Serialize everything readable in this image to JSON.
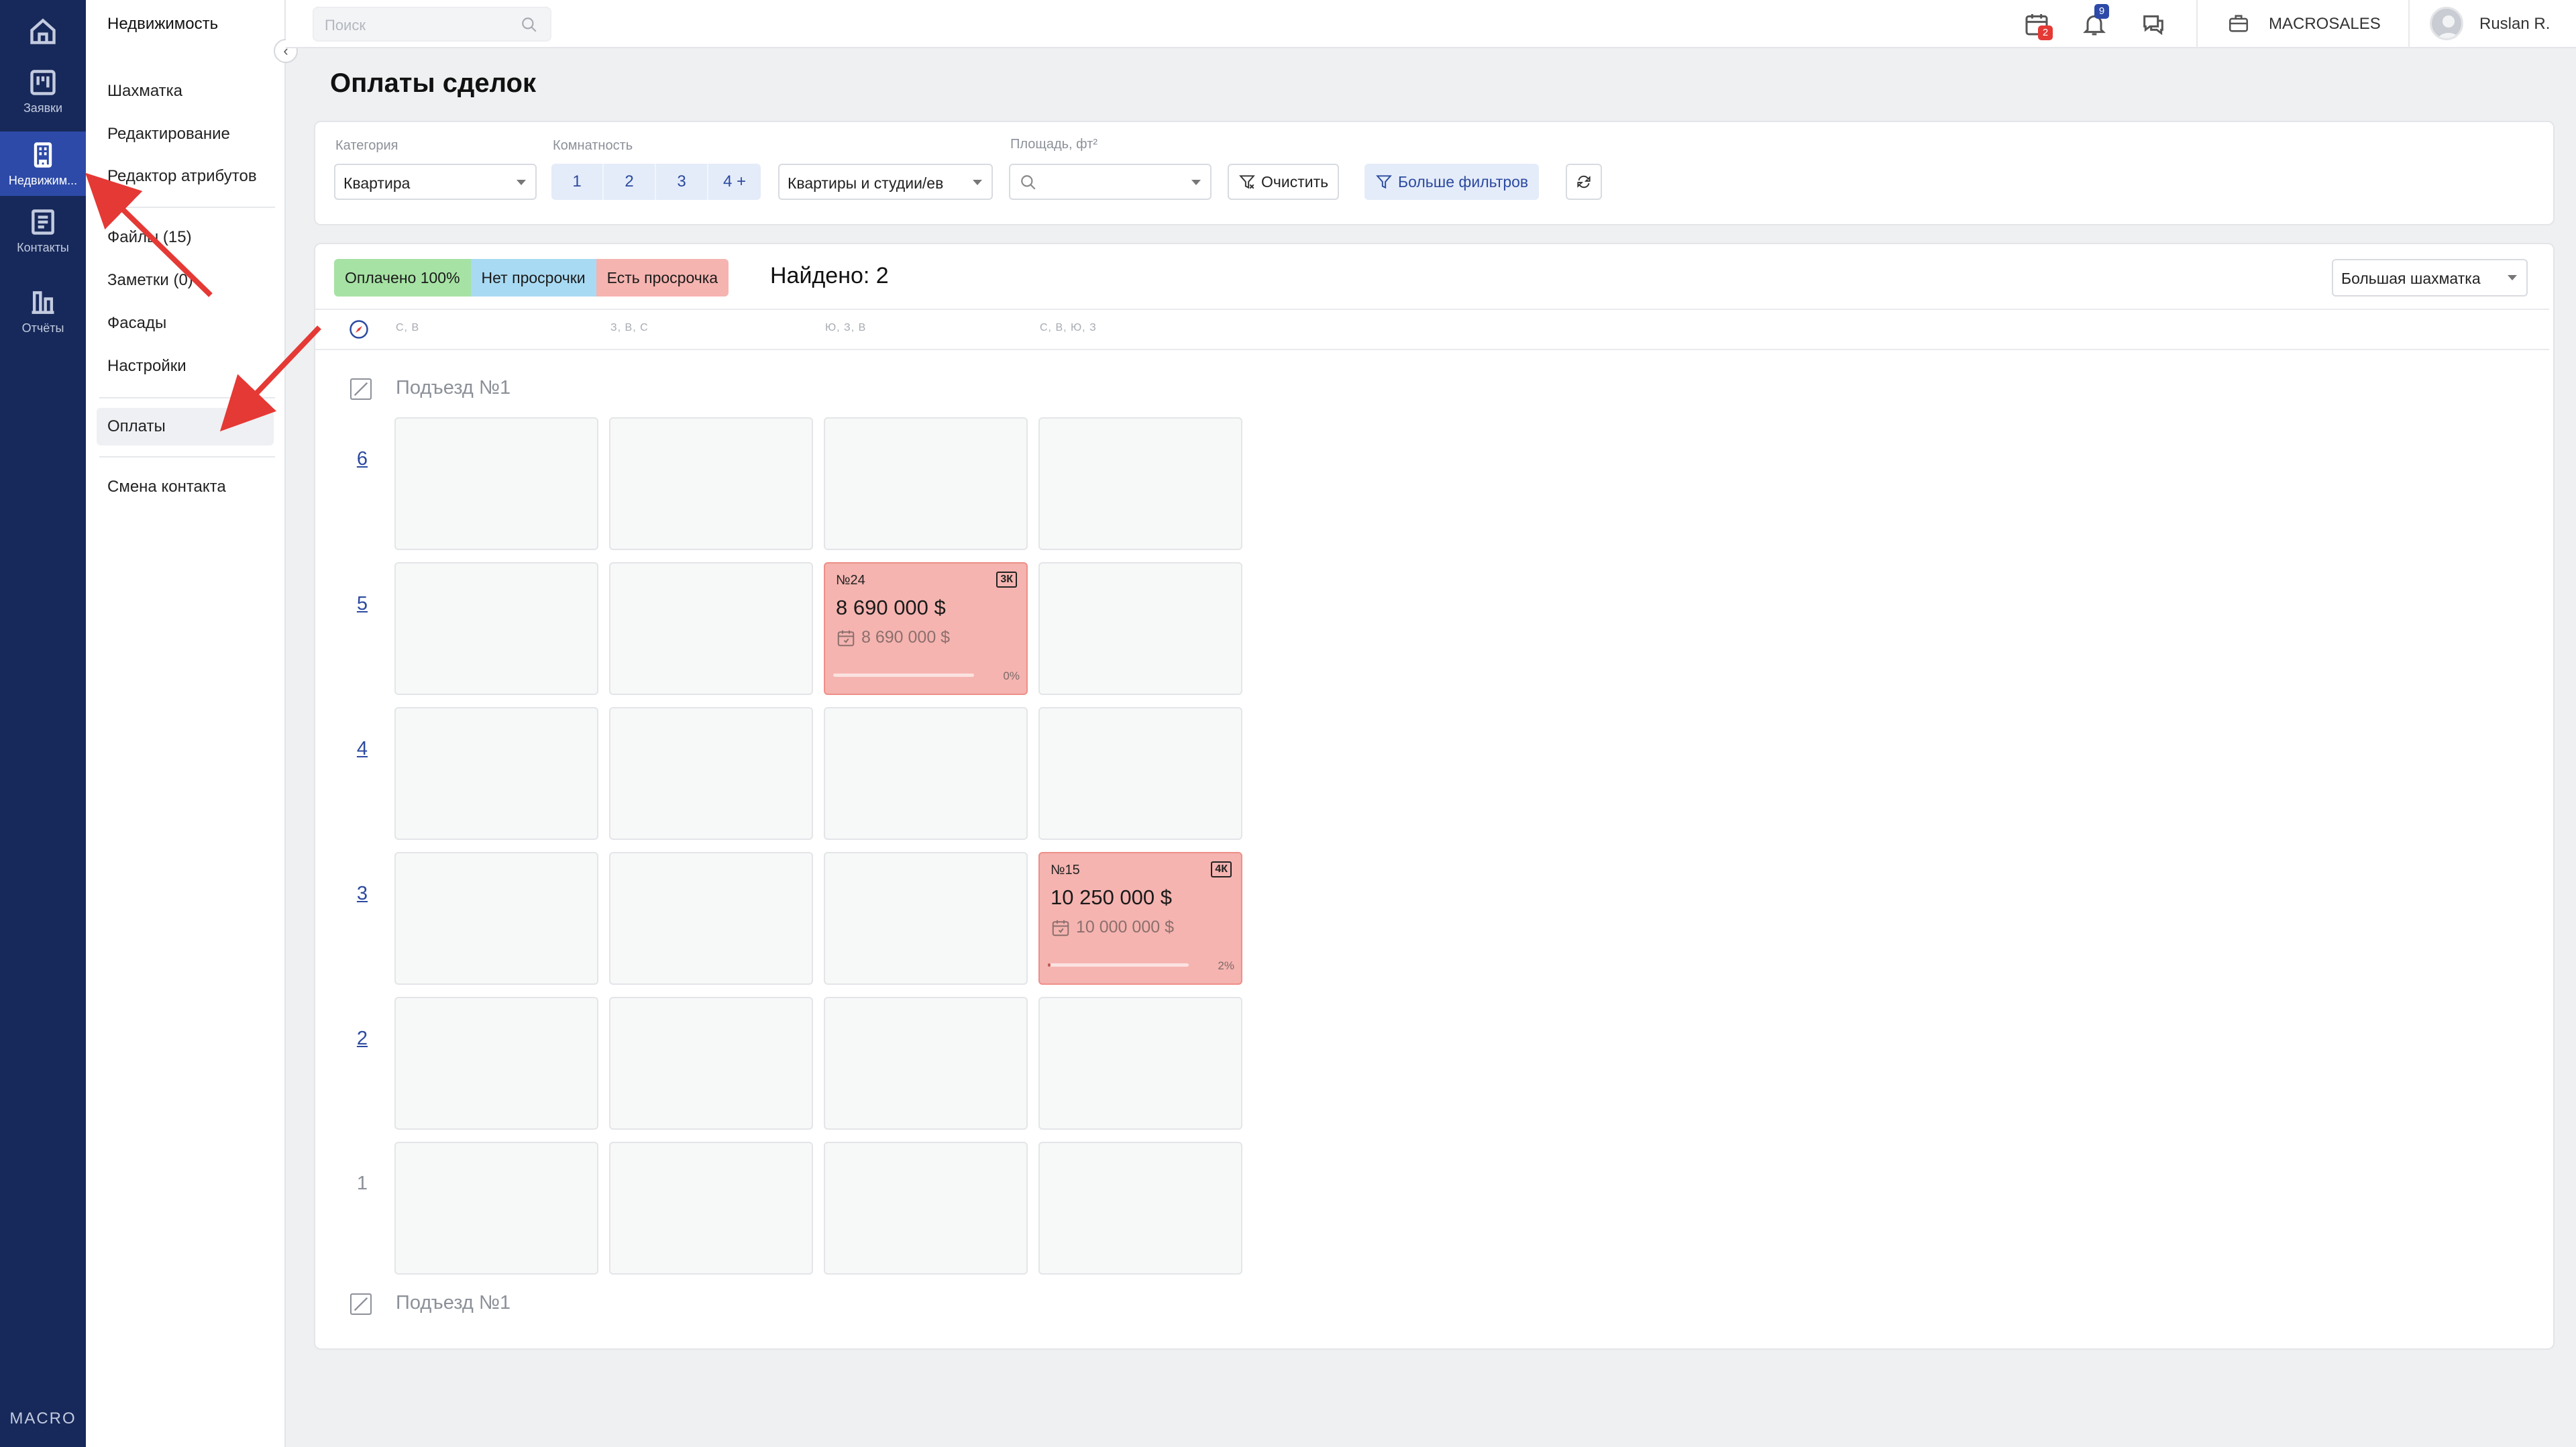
{
  "rail": {
    "items": [
      {
        "label": "",
        "icon": "home-icon"
      },
      {
        "label": "Заявки",
        "icon": "kanban-icon"
      },
      {
        "label": "Недвижим...",
        "icon": "building-icon"
      },
      {
        "label": "Контакты",
        "icon": "contacts-icon"
      },
      {
        "label": "Отчёты",
        "icon": "reports-icon"
      }
    ],
    "logo": "MACRO"
  },
  "sidebar": {
    "title": "Недвижимость",
    "items": [
      "Шахматка",
      "Редактирование",
      "Редактор атрибутов",
      "Файлы (15)",
      "Заметки (0)",
      "Фасады",
      "Настройки",
      "Оплаты",
      "Смена контакта"
    ],
    "active": "Оплаты"
  },
  "topbar": {
    "search_placeholder": "Поиск",
    "calendar_badge": "2",
    "bell_badge": "9",
    "company": "MACROSALES",
    "user": "Ruslan R."
  },
  "page": {
    "title": "Оплаты сделок"
  },
  "filters": {
    "category_label": "Категория",
    "category_value": "Квартира",
    "rooms_label": "Комнатность",
    "rooms": [
      "1",
      "2",
      "3",
      "4 +"
    ],
    "type_value": "Квартиры и студии/ев",
    "area_label": "Площадь, фт²",
    "clear_label": "Очистить",
    "more_label": "Больше фильтров"
  },
  "legend": [
    {
      "label": "Оплачено 100%",
      "color": "#a6e2a4"
    },
    {
      "label": "Нет просрочки",
      "color": "#a9daf3"
    },
    {
      "label": "Есть просрочка",
      "color": "#f5b4b0"
    }
  ],
  "found": "Найдено: 2",
  "view_select": "Большая шахматка",
  "directions": [
    "С, В",
    "З, В, С",
    "Ю, З, В",
    "С, В, Ю, З"
  ],
  "entrance": {
    "top": "Подъезд №1",
    "bottom": "Подъезд №1"
  },
  "floors": [
    "6",
    "5",
    "4",
    "3",
    "2",
    "1"
  ],
  "apartments": [
    {
      "number": "№24",
      "rooms_tag": "3К",
      "price": "8 690 000 $",
      "paid_price": "8 690 000 $",
      "progress": 0,
      "progress_label": "0%",
      "floor": "5",
      "column": 3
    },
    {
      "number": "№15",
      "rooms_tag": "4К",
      "price": "10 250 000 $",
      "paid_price": "10 000 000 $",
      "progress": 0.02,
      "progress_label": "2%",
      "floor": "3",
      "column": 4
    }
  ],
  "colors": {
    "rail": "#17295a",
    "accent": "#2d4aa8",
    "overdue": "#f5b4b0",
    "arrow": "#e53935"
  }
}
